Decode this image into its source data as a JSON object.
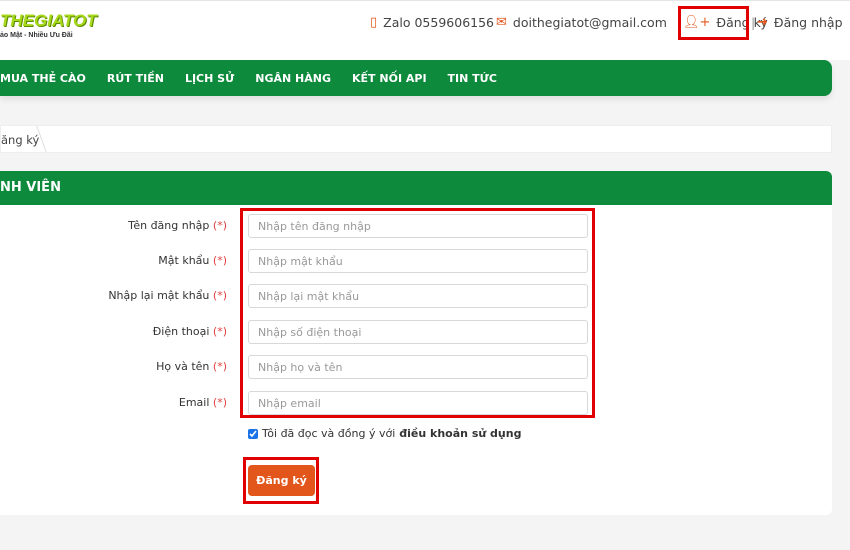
{
  "header": {
    "logo_text": "THEGIATOT",
    "tagline": "ảo Mật - Nhiều Ưu Đãi",
    "phone_icon": "mobile-phone-icon",
    "phone": "Zalo 0559606156",
    "email_icon": "envelope-icon",
    "email": "doithegiatot@gmail.com",
    "register_icon": "user-plus-icon",
    "register": "Đăng ký",
    "separator": "|",
    "login_icon": "sign-in-icon",
    "login": "Đăng nhập"
  },
  "nav": {
    "items": [
      "MUA THẺ CÀO",
      "RÚT TIỀN",
      "LỊCH SỬ",
      "NGÂN HÀNG",
      "KẾT NỐI API",
      "TIN TỨC"
    ]
  },
  "breadcrumb": {
    "current": "ăng ký"
  },
  "panel": {
    "title": "NH VIÊN",
    "fields": [
      {
        "label": "Tên đăng nhập",
        "required": "(*)",
        "placeholder": "Nhập tên đăng nhập",
        "value": ""
      },
      {
        "label": "Mật khẩu",
        "required": "(*)",
        "placeholder": "Nhập mật khẩu",
        "value": ""
      },
      {
        "label": "Nhập lại mật khẩu",
        "required": "(*)",
        "placeholder": "Nhập lại mật khẩu",
        "value": ""
      },
      {
        "label": "Điện thoại",
        "required": "(*)",
        "placeholder": "Nhập số điện thoại",
        "value": ""
      },
      {
        "label": "Họ và tên",
        "required": "(*)",
        "placeholder": "Nhập họ và tên",
        "value": ""
      },
      {
        "label": "Email",
        "required": "(*)",
        "placeholder": "Nhập email",
        "value": ""
      }
    ],
    "agree_text": "Tôi đã đọc và đồng ý với ",
    "agree_link": "điều khoản sử dụng",
    "agree_checked": true,
    "submit": "Đăng ký"
  },
  "colors": {
    "brand_green": "#0d8a3c",
    "accent_orange": "#e2561b",
    "highlight_red": "#e00000"
  }
}
